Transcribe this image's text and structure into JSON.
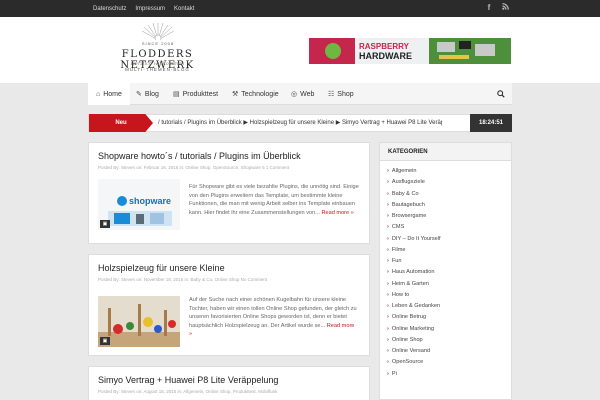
{
  "topbar": {
    "links": [
      "Datenschutz",
      "Impressum",
      "Kontakt"
    ],
    "social": [
      {
        "icon": "facebook-icon",
        "glyph": "f"
      },
      {
        "icon": "rss-icon",
        "glyph": "≡"
      }
    ]
  },
  "logo": {
    "since": "SINCE 2008",
    "name": "FLODDERS NETZWERK",
    "script": "Herzlich willkommen",
    "sub": "MULTI-THEMEN-BLOG"
  },
  "banner": {
    "line1": "RASPBERRY",
    "line2": "HARDWARE"
  },
  "nav": {
    "items": [
      {
        "label": "Home",
        "icon": "home-icon",
        "glyph": "⌂"
      },
      {
        "label": "Blog",
        "icon": "pencil-icon",
        "glyph": "✎"
      },
      {
        "label": "Produkttest",
        "icon": "box-icon",
        "glyph": "▤"
      },
      {
        "label": "Technologie",
        "icon": "wrench-icon",
        "glyph": "⚒"
      },
      {
        "label": "Web",
        "icon": "globe-icon",
        "glyph": "◎"
      },
      {
        "label": "Shop",
        "icon": "cart-icon",
        "glyph": "☷"
      }
    ],
    "search_icon": "search-icon"
  },
  "ticker": {
    "label": "Neu",
    "text": "/ tutorials / Plugins im Überblick   ▶ Holzspielzeug für unsere Kleine   ▶ Simyo Vertrag + Huawei P8 Lite Veräp",
    "time": "18:24:51"
  },
  "posts": [
    {
      "title": "Shopware howto´s / tutorials / Plugins im Überblick",
      "meta": "Posted By: Steven   on: Februar 16, 2016   in: Online Shop, OpenSource, Shopware 5   1 Comment",
      "excerpt": "Für Shopware gibt es viele bezahlte Plugins, die unnötig sind. Einige von den Plugins erweitern das Template, um bestimmte kleine Funktionen, die man mit wenig Arbeit selber ins Template einbauen kann. Hier findet ihr eine Zusammenstellungen von...",
      "more": "Read more »"
    },
    {
      "title": "Holzspielzeug für unsere Kleine",
      "meta": "Posted By: Steven   on: November 18, 2015   in: Baby & Co, Online Shop   No Comment",
      "excerpt": "Auf der Suche nach einer schönen Kugelbahn für unsere kleine Tochter, haben wir einen tollen Online Shop gefunden, der gleich zu unseren favorisierten Online Shops geworden ist, denn er bietet hauptsächlich Holzspielzeug an. Der Artikel wurde se...",
      "more": "Read more »"
    },
    {
      "title": "Simyo Vertrag + Huawei P8 Lite Veräppelung",
      "meta": "Posted By: Steven   on: August 15, 2015   in: Allgemein, Online Shop, Produkttest, Mobilfunk"
    }
  ],
  "sidebar": {
    "title": "KATEGORIEN",
    "items": [
      "Allgemein",
      "Ausflugsziele",
      "Baby & Co",
      "Bautagebuch",
      "Browsergame",
      "CMS",
      "DIY – Do It Yourself",
      "Filme",
      "Fun",
      "Haus Automation",
      "Heim & Garten",
      "How to",
      "Leben & Gedanken",
      "Online Betrug",
      "Online Marketing",
      "Online Shop",
      "Online Versand",
      "OpenSource",
      "Pi"
    ]
  },
  "colors": {
    "accent": "#c7151c",
    "topbar": "#2b2b2b",
    "time_bg": "#333333"
  }
}
